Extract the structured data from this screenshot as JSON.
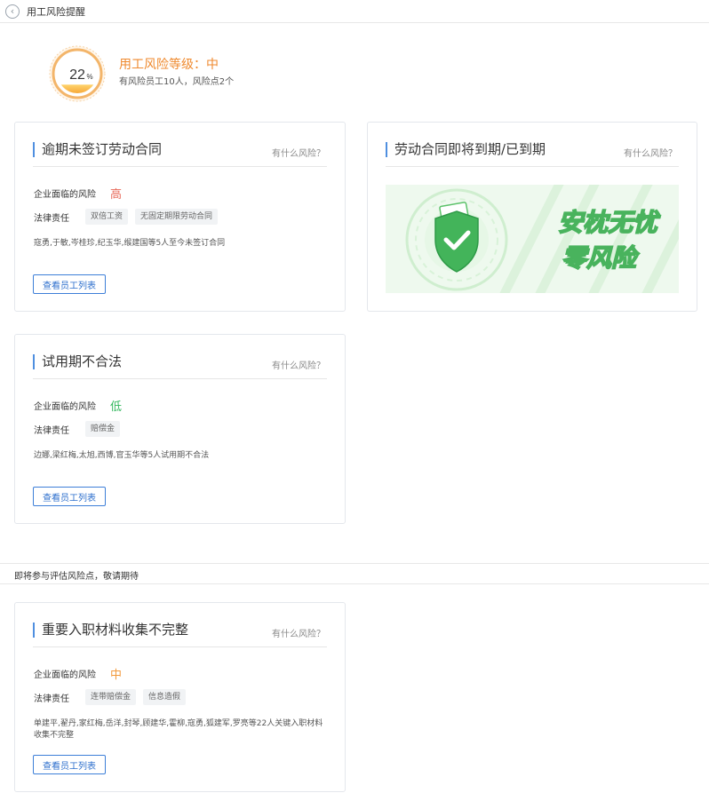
{
  "header": {
    "title": "用工风险提醒"
  },
  "summary": {
    "percent": "22",
    "percent_unit": "%",
    "level_text": "用工风险等级：中",
    "detail_text": "有风险员工10人，风险点2个",
    "gauge_fill_fraction": 0.22
  },
  "labels": {
    "risk_label": "企业面临的风险",
    "liability_label": "法律责任",
    "help": "有什么风险？",
    "view_button": "查看员工列表"
  },
  "cards": {
    "overdue_contract": {
      "title": "逾期未签订劳动合同",
      "risk": "高",
      "tags": [
        "双倍工资",
        "无固定期限劳动合同"
      ],
      "employees": "寇勇,于敏,岑桂珍,纪玉华,缑建国等5人至今未签订合同"
    },
    "contract_expiring": {
      "title": "劳动合同即将到期/已到期",
      "banner_text_line1": "安枕无忧",
      "banner_text_line2": "零风险"
    },
    "probation": {
      "title": "试用期不合法",
      "risk": "低",
      "tags": [
        "赔偿金"
      ],
      "employees": "边娜,梁红梅,太旭,西博,官玉华等5人试用期不合法"
    },
    "onboarding_docs": {
      "title": "重要入职材料收集不完整",
      "risk": "中",
      "tags": [
        "连带赔偿金",
        "信息造假"
      ],
      "employees": "单建平,翟丹,家红梅,岳洋,封琴,顾建华,霍柳,寇勇,狐建军,罗亮等22人关键入职材料收集不完整"
    }
  },
  "band": {
    "text": "即将参与评估风险点，敬请期待"
  },
  "colors": {
    "accent_blue": "#3d7fd8",
    "risk_high": "#e86a5a",
    "risk_low": "#35b85f",
    "risk_mid": "#f29a3c",
    "level_orange": "#ef8a2f"
  },
  "icons": {
    "back": "chevron-left-icon",
    "shield": "shield-check-icon"
  }
}
